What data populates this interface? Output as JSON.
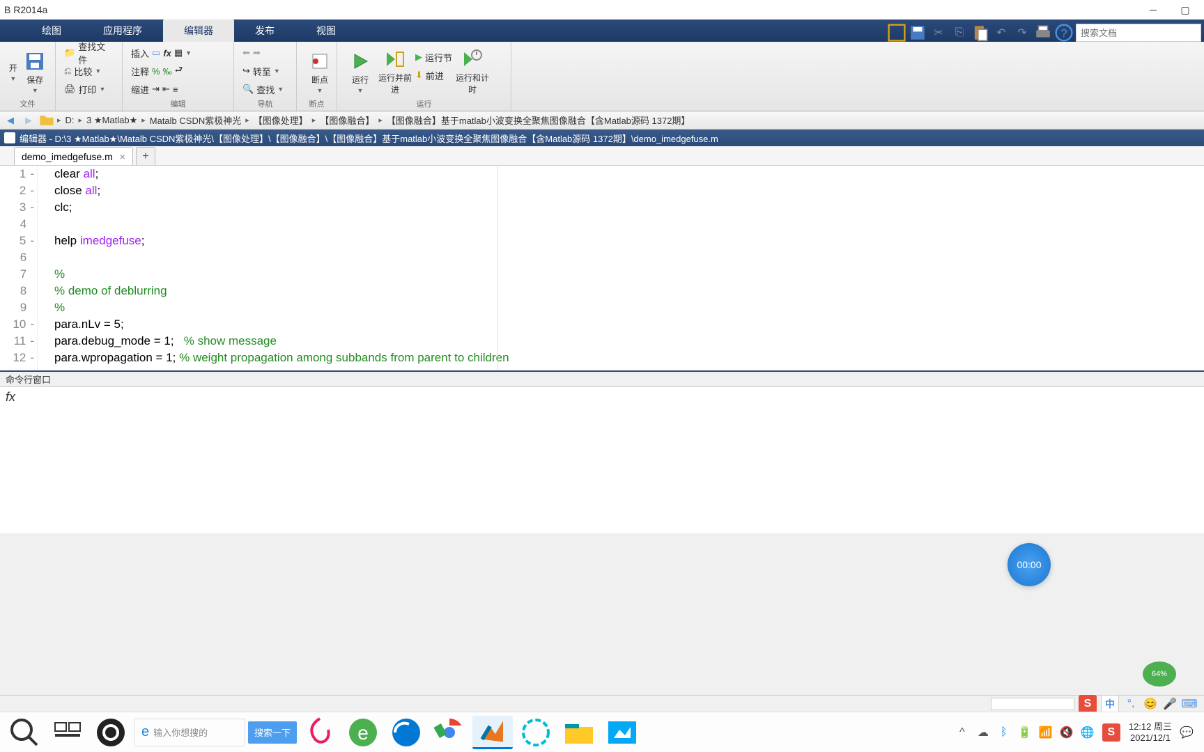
{
  "titlebar": {
    "title": "B R2014a"
  },
  "tabs": {
    "t1": "绘图",
    "t2": "应用程序",
    "t3": "编辑器",
    "t4": "发布",
    "t5": "视图"
  },
  "search": {
    "placeholder": "搜索文档"
  },
  "toolstrip": {
    "open": "开",
    "save": "保存",
    "findFiles": "查找文件",
    "compare": "比较",
    "print": "打印",
    "insert": "插入",
    "comment": "注释",
    "indent": "缩进",
    "goto": "转至",
    "find": "查找",
    "breakpoints": "断点",
    "run": "运行",
    "runAdvance": "运行并前进",
    "runSection": "运行节",
    "advance": "前进",
    "runTime": "运行和计时",
    "groups": {
      "file": "文件",
      "edit": "编辑",
      "nav": "导航",
      "bp": "断点",
      "run": "运行"
    }
  },
  "address": {
    "drive": "D:",
    "p1": "3 ★Matlab★",
    "p2": "Matalb CSDN紫极神光",
    "p3": "【图像处理】",
    "p4": "【图像融合】",
    "p5": "【图像融合】基于matlab小波变换全聚焦图像融合【含Matlab源码 1372期】"
  },
  "editor": {
    "header": "编辑器 - D:\\3 ★Matlab★\\Matalb CSDN紫极神光\\【图像处理】\\【图像融合】\\【图像融合】基于matlab小波变换全聚焦图像融合【含Matlab源码 1372期】\\demo_imedgefuse.m",
    "tabName": "demo_imedgefuse.m"
  },
  "code": {
    "lines": [
      {
        "n": "1",
        "dash": "-",
        "tokens": [
          {
            "t": "clear ",
            "c": "norm"
          },
          {
            "t": "all",
            "c": "str"
          },
          {
            "t": ";",
            "c": "norm"
          }
        ]
      },
      {
        "n": "2",
        "dash": "-",
        "tokens": [
          {
            "t": "close ",
            "c": "norm"
          },
          {
            "t": "all",
            "c": "str"
          },
          {
            "t": ";",
            "c": "norm"
          }
        ]
      },
      {
        "n": "3",
        "dash": "-",
        "tokens": [
          {
            "t": "clc;",
            "c": "norm"
          }
        ]
      },
      {
        "n": "4",
        "dash": "",
        "tokens": []
      },
      {
        "n": "5",
        "dash": "-",
        "tokens": [
          {
            "t": "help ",
            "c": "norm"
          },
          {
            "t": "imedgefuse",
            "c": "str"
          },
          {
            "t": ";",
            "c": "norm"
          }
        ]
      },
      {
        "n": "6",
        "dash": "",
        "tokens": []
      },
      {
        "n": "7",
        "dash": "",
        "tokens": [
          {
            "t": "%",
            "c": "com"
          }
        ]
      },
      {
        "n": "8",
        "dash": "",
        "tokens": [
          {
            "t": "% demo of deblurring",
            "c": "com"
          }
        ]
      },
      {
        "n": "9",
        "dash": "",
        "tokens": [
          {
            "t": "%",
            "c": "com"
          }
        ]
      },
      {
        "n": "10",
        "dash": "-",
        "tokens": [
          {
            "t": "para.nLv = 5;",
            "c": "norm"
          }
        ]
      },
      {
        "n": "11",
        "dash": "-",
        "tokens": [
          {
            "t": "para.debug_mode = 1;   ",
            "c": "norm"
          },
          {
            "t": "% show message",
            "c": "com"
          }
        ]
      },
      {
        "n": "12",
        "dash": "-",
        "tokens": [
          {
            "t": "para.wpropagation = 1; ",
            "c": "norm"
          },
          {
            "t": "% weight propagation among subbands from parent to children",
            "c": "com"
          }
        ]
      }
    ]
  },
  "cmd": {
    "title": "命令行窗口"
  },
  "timer": "00:00",
  "battery": "64%",
  "status": {
    "cn": "中"
  },
  "taskbar": {
    "searchPlaceholder": "输入你想搜的",
    "searchBtn": "搜索一下",
    "time": "12:12 周三",
    "date": "2021/12/1"
  }
}
